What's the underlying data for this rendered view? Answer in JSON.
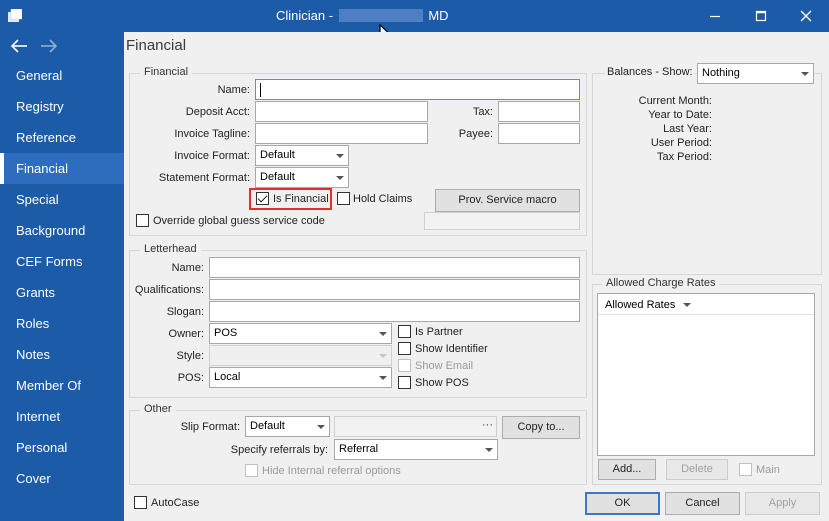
{
  "window": {
    "title_prefix": "Clinician -",
    "title_suffix": "MD",
    "minimize_icon": "minimize-icon",
    "maximize_icon": "maximize-icon",
    "close_icon": "close-icon"
  },
  "nav": {
    "back_icon": "arrow-left-icon",
    "forward_icon": "arrow-right-icon",
    "pane_title": "Financial"
  },
  "sidebar": {
    "items": [
      {
        "label": "General"
      },
      {
        "label": "Registry"
      },
      {
        "label": "Reference"
      },
      {
        "label": "Financial",
        "active": true
      },
      {
        "label": "Special"
      },
      {
        "label": "Background"
      },
      {
        "label": "CEF Forms"
      },
      {
        "label": "Grants"
      },
      {
        "label": "Roles"
      },
      {
        "label": "Notes"
      },
      {
        "label": "Member Of"
      },
      {
        "label": "Internet"
      },
      {
        "label": "Personal"
      },
      {
        "label": "Cover"
      }
    ]
  },
  "financial": {
    "group_title": "Financial",
    "name_label": "Name:",
    "name_value": "",
    "deposit_label": "Deposit Acct:",
    "tax_label": "Tax:",
    "tagline_label": "Invoice Tagline:",
    "payee_label": "Payee:",
    "invoice_format_label": "Invoice Format:",
    "invoice_format_value": "Default",
    "statement_format_label": "Statement Format:",
    "statement_format_value": "Default",
    "is_financial_label": "Is Financial",
    "is_financial_checked": true,
    "hold_claims_label": "Hold Claims",
    "prov_macro_button": "Prov. Service macro",
    "override_label": "Override global guess service code"
  },
  "letterhead": {
    "group_title": "Letterhead",
    "name_label": "Name:",
    "qualifications_label": "Qualifications:",
    "slogan_label": "Slogan:",
    "owner_label": "Owner:",
    "owner_value": "POS",
    "style_label": "Style:",
    "style_value": "",
    "pos_label": "POS:",
    "pos_value": "Local",
    "is_partner_label": "Is Partner",
    "show_identifier_label": "Show Identifier",
    "show_email_label": "Show Email",
    "show_pos_label": "Show POS"
  },
  "other": {
    "group_title": "Other",
    "slip_format_label": "Slip Format:",
    "slip_format_value": "Default",
    "ellipsis": "···",
    "copy_to_button": "Copy to...",
    "referrals_label": "Specify referrals by:",
    "referrals_value": "Referral",
    "hide_internal_label": "Hide Internal referral options"
  },
  "balances": {
    "show_label": "Balances - Show:",
    "show_value": "Nothing",
    "rows": [
      "Current Month:",
      "Year to Date:",
      "Last Year:",
      "User Period:",
      "Tax Period:"
    ]
  },
  "charge_rates": {
    "group_title": "Allowed Charge Rates",
    "list_header": "Allowed Rates",
    "add_button": "Add...",
    "delete_button": "Delete",
    "main_label": "Main"
  },
  "footer": {
    "autocase_label": "AutoCase",
    "ok_button": "OK",
    "cancel_button": "Cancel",
    "apply_button": "Apply"
  }
}
